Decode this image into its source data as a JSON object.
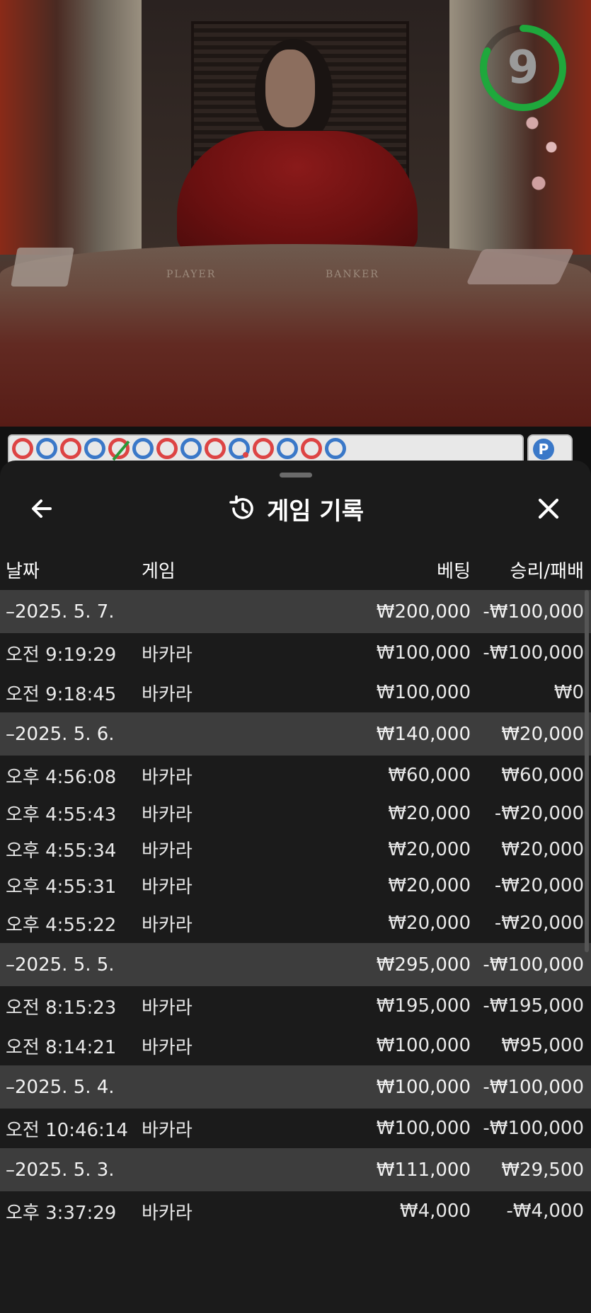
{
  "video": {
    "table_labels": {
      "player": "PLAYER",
      "banker": "BANKER"
    },
    "timer": {
      "value": "9",
      "progress": 0.82,
      "color": "#1fa83c"
    }
  },
  "roadmap": {
    "beads": [
      "P",
      "B",
      "P",
      "B",
      "T",
      "B",
      "P",
      "B",
      "P",
      "B",
      "P",
      "B",
      "P",
      "B"
    ],
    "colors": {
      "P": "#d44444",
      "B": "#3a78c8",
      "T": "#2a9a3a"
    }
  },
  "history": {
    "title": "게임 기록",
    "title_icon": "history-icon",
    "back_icon": "arrow-left-icon",
    "close_icon": "close-icon",
    "columns": {
      "date": "날짜",
      "game": "게임",
      "bet": "베팅",
      "win_loss": "승리/패배"
    },
    "groups": [
      {
        "date": "–2025. 5. 7.",
        "bet": "₩200,000",
        "win_loss": "-₩100,000",
        "games": [
          {
            "time": "오전 9:19:29",
            "game": "바카라",
            "bet": "₩100,000",
            "win_loss": "-₩100,000"
          },
          {
            "time": "오전 9:18:45",
            "game": "바카라",
            "bet": "₩100,000",
            "win_loss": "₩0"
          }
        ]
      },
      {
        "date": "–2025. 5. 6.",
        "bet": "₩140,000",
        "win_loss": "₩20,000",
        "games": [
          {
            "time": "오후 4:56:08",
            "game": "바카라",
            "bet": "₩60,000",
            "win_loss": "₩60,000"
          },
          {
            "time": "오후 4:55:43",
            "game": "바카라",
            "bet": "₩20,000",
            "win_loss": "-₩20,000"
          },
          {
            "time": "오후 4:55:34",
            "game": "바카라",
            "bet": "₩20,000",
            "win_loss": "₩20,000"
          },
          {
            "time": "오후 4:55:31",
            "game": "바카라",
            "bet": "₩20,000",
            "win_loss": "-₩20,000"
          },
          {
            "time": "오후 4:55:22",
            "game": "바카라",
            "bet": "₩20,000",
            "win_loss": "-₩20,000"
          }
        ]
      },
      {
        "date": "–2025. 5. 5.",
        "bet": "₩295,000",
        "win_loss": "-₩100,000",
        "games": [
          {
            "time": "오전 8:15:23",
            "game": "바카라",
            "bet": "₩195,000",
            "win_loss": "-₩195,000"
          },
          {
            "time": "오전 8:14:21",
            "game": "바카라",
            "bet": "₩100,000",
            "win_loss": "₩95,000"
          }
        ]
      },
      {
        "date": "–2025. 5. 4.",
        "bet": "₩100,000",
        "win_loss": "-₩100,000",
        "games": [
          {
            "time": "오전 10:46:14",
            "game": "바카라",
            "bet": "₩100,000",
            "win_loss": "-₩100,000"
          }
        ]
      },
      {
        "date": "–2025. 5. 3.",
        "bet": "₩111,000",
        "win_loss": "₩29,500",
        "games": [
          {
            "time": "오후 3:37:29",
            "game": "바카라",
            "bet": "₩4,000",
            "win_loss": "-₩4,000"
          }
        ]
      }
    ]
  }
}
